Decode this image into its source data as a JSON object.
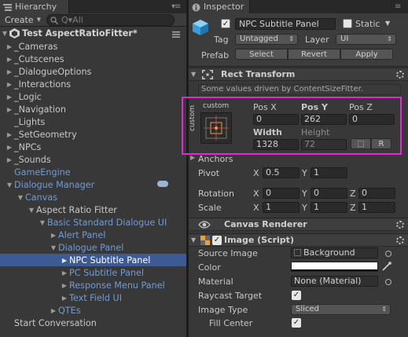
{
  "hierarchy": {
    "tab_title": "Hierarchy",
    "create_label": "Create",
    "search_placeholder": "Q▾All",
    "scene_name": "Test AspectRatioFitter*",
    "items": [
      {
        "label": "_Cameras",
        "indent": 1,
        "arrow": "▶",
        "style": "normal"
      },
      {
        "label": "_Cutscenes",
        "indent": 1,
        "arrow": "▶",
        "style": "normal"
      },
      {
        "label": "_DialogueOptions",
        "indent": 1,
        "arrow": "▶",
        "style": "normal"
      },
      {
        "label": "_Interactions",
        "indent": 1,
        "arrow": "▶",
        "style": "normal"
      },
      {
        "label": "_Logic",
        "indent": 1,
        "arrow": "▶",
        "style": "normal"
      },
      {
        "label": "_Navigation",
        "indent": 1,
        "arrow": "▶",
        "style": "normal"
      },
      {
        "label": "_Lights",
        "indent": 1,
        "arrow": "",
        "style": "normal"
      },
      {
        "label": "_SetGeometry",
        "indent": 1,
        "arrow": "▶",
        "style": "normal"
      },
      {
        "label": "_NPCs",
        "indent": 1,
        "arrow": "▶",
        "style": "normal"
      },
      {
        "label": "_Sounds",
        "indent": 1,
        "arrow": "▶",
        "style": "normal"
      },
      {
        "label": "GameEngine",
        "indent": 1,
        "arrow": "",
        "style": "blue"
      },
      {
        "label": "Dialogue Manager",
        "indent": 1,
        "arrow": "▼",
        "style": "blue"
      },
      {
        "label": "Canvas",
        "indent": 2,
        "arrow": "▼",
        "style": "blue"
      },
      {
        "label": "Aspect Ratio Fitter",
        "indent": 3,
        "arrow": "▼",
        "style": "normal"
      },
      {
        "label": "Basic Standard Dialogue UI",
        "indent": 4,
        "arrow": "▼",
        "style": "blue"
      },
      {
        "label": "Alert Panel",
        "indent": 5,
        "arrow": "▶",
        "style": "blue"
      },
      {
        "label": "Dialogue Panel",
        "indent": 5,
        "arrow": "▼",
        "style": "blue"
      },
      {
        "label": "NPC Subtitle Panel",
        "indent": 6,
        "arrow": "▶",
        "style": "selected"
      },
      {
        "label": "PC Subtitle Panel",
        "indent": 6,
        "arrow": "▶",
        "style": "blue"
      },
      {
        "label": "Response Menu Panel",
        "indent": 6,
        "arrow": "▶",
        "style": "blue"
      },
      {
        "label": "Text Field UI",
        "indent": 6,
        "arrow": "▶",
        "style": "blue"
      },
      {
        "label": "QTEs",
        "indent": 5,
        "arrow": "▶",
        "style": "blue"
      },
      {
        "label": "Start Conversation",
        "indent": 1,
        "arrow": "",
        "style": "normal"
      }
    ]
  },
  "inspector": {
    "tab_title": "Inspector",
    "object_name": "NPC Subtitle Panel",
    "static_label": "Static",
    "tag_label": "Tag",
    "tag_value": "Untagged",
    "layer_label": "Layer",
    "layer_value": "UI",
    "prefab_label": "Prefab",
    "prefab_buttons": [
      "Select",
      "Revert",
      "Apply"
    ],
    "rect_transform": {
      "title": "Rect Transform",
      "info": "Some values driven by ContentSizeFitter.",
      "anchor_preset_h": "custom",
      "anchor_preset_v": "custom",
      "pos_x_label": "Pos X",
      "pos_y_label": "Pos Y",
      "pos_z_label": "Pos Z",
      "pos_x": "0",
      "pos_y": "262",
      "pos_z": "0",
      "width_label": "Width",
      "height_label": "Height",
      "width": "1328",
      "height": "72",
      "blueprint_btn": "⬚",
      "raw_btn": "R",
      "anchors_label": "Anchors",
      "pivot_label": "Pivot",
      "pivot_x": "0.5",
      "pivot_y": "1",
      "rotation_label": "Rotation",
      "rot_x": "0",
      "rot_y": "0",
      "rot_z": "0",
      "scale_label": "Scale",
      "scale_x": "1",
      "scale_y": "1",
      "scale_z": "1",
      "x": "X",
      "y": "Y",
      "z": "Z"
    },
    "canvas_renderer": {
      "title": "Canvas Renderer"
    },
    "image": {
      "title": "Image (Script)",
      "source_image_label": "Source Image",
      "source_image_value": "Background",
      "color_label": "Color",
      "material_label": "Material",
      "material_value": "None (Material)",
      "raycast_label": "Raycast Target",
      "image_type_label": "Image Type",
      "image_type_value": "Sliced",
      "fill_center_label": "Fill Center"
    }
  },
  "colors": {
    "selection": "#3d5a92",
    "highlight_box": "#e229d8",
    "blue_text": "#6f9bd8"
  }
}
